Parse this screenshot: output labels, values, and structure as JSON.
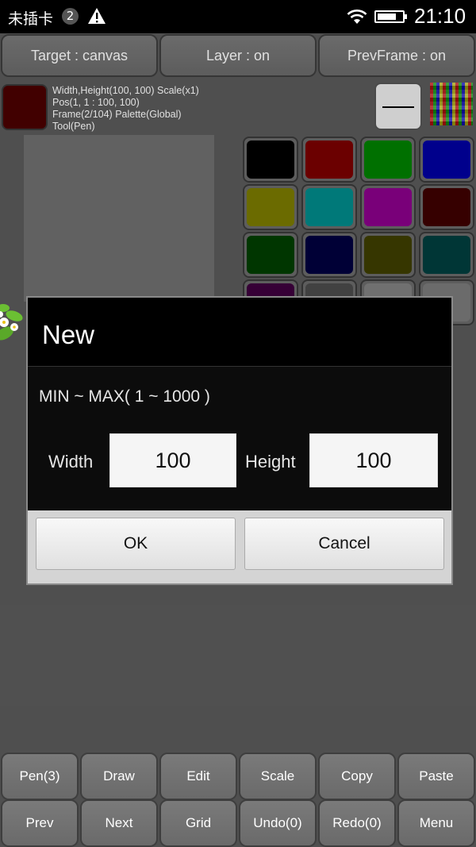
{
  "status_bar": {
    "carrier": "未插卡",
    "sim_badge": "2",
    "time": "21:10",
    "battery_level": 0.75
  },
  "top_toggles": {
    "target": "Target : canvas",
    "layer": "Layer : on",
    "prev_frame": "PrevFrame : on"
  },
  "current_color": "#4a0000",
  "info": {
    "line1": "Width,Height(100, 100)  Scale(x1)",
    "line2": "Pos(1, 1 : 100, 100)",
    "line3": "Frame(2/104)  Palette(Global)",
    "line4": "Tool(Pen)"
  },
  "palette": [
    "#000000",
    "#7a0000",
    "#008000",
    "#0000a0",
    "#7a7a00",
    "#008a8a",
    "#8a008a",
    "#3e0000",
    "#003e00",
    "#00003e",
    "#3e3e00",
    "#003e3e",
    "#3e003e",
    "#4a4a4a",
    "#808080",
    "#7a7a7a"
  ],
  "dialog": {
    "title": "New",
    "range_text": "MIN ~ MAX( 1 ~ 1000 )",
    "width_label": "Width",
    "width_value": "100",
    "height_label": "Height",
    "height_value": "100",
    "ok_label": "OK",
    "cancel_label": "Cancel"
  },
  "bottom_toolbar": {
    "row1": [
      "Pen(3)",
      "Draw",
      "Edit",
      "Scale",
      "Copy",
      "Paste"
    ],
    "row2": [
      "Prev",
      "Next",
      "Grid",
      "Undo(0)",
      "Redo(0)",
      "Menu"
    ]
  }
}
